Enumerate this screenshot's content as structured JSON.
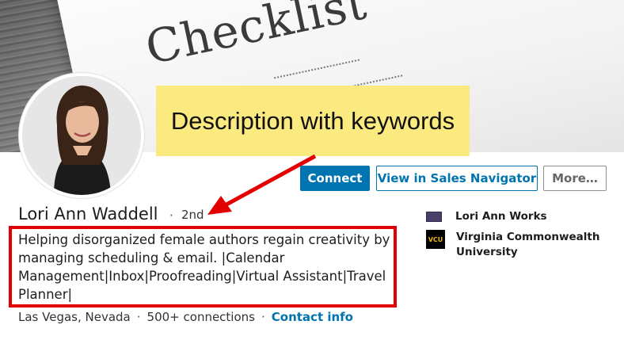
{
  "banner": {
    "image_text": "Checklist"
  },
  "callout": {
    "text": "Description with keywords"
  },
  "actions": {
    "connect_label": "Connect",
    "sales_navigator_label": "View in Sales Navigator",
    "more_label": "More…"
  },
  "profile": {
    "name": "Lori Ann Waddell",
    "separator": "·",
    "degree": "2nd",
    "headline": "Helping disorganized female authors regain creativity by managing scheduling & email. |Calendar Management|Inbox|Proofreading|Virtual Assistant|Travel Planner|",
    "location": "Las Vegas, Nevada",
    "connections": "500+ connections",
    "contact_info_label": "Contact info"
  },
  "experience": [
    {
      "label": "Lori Ann Works",
      "icon": "company-logo-icon"
    },
    {
      "label": "Virginia Commonwealth University",
      "icon": "vcu-logo-icon",
      "logo_text": "VCU"
    }
  ],
  "colors": {
    "accent": "#0073b1",
    "highlight_border": "#e20000",
    "callout_bg": "#fbea7f"
  }
}
